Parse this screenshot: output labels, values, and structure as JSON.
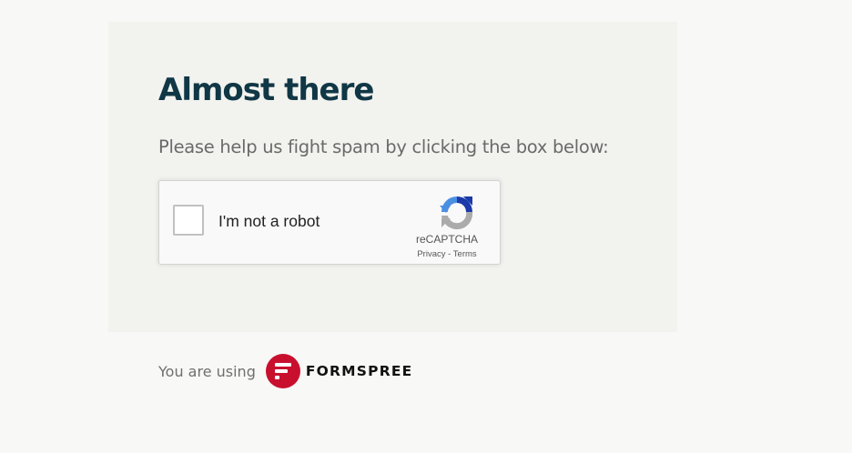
{
  "card": {
    "title": "Almost there",
    "subtitle": "Please help us fight spam by clicking the box below:"
  },
  "recaptcha": {
    "label": "I'm not a robot",
    "brand": "reCAPTCHA",
    "privacy": "Privacy",
    "separator": " - ",
    "terms": "Terms",
    "checked": false,
    "icon": "recaptcha-logo-icon"
  },
  "footer": {
    "text": "You are using",
    "brand_name": "FORMSPREE",
    "brand_icon": "formspree-logo-icon",
    "brand_color": "#c8102e"
  },
  "colors": {
    "title": "#103745",
    "page_background": "#f8f8f6",
    "card_background": "#f2f2ef"
  }
}
